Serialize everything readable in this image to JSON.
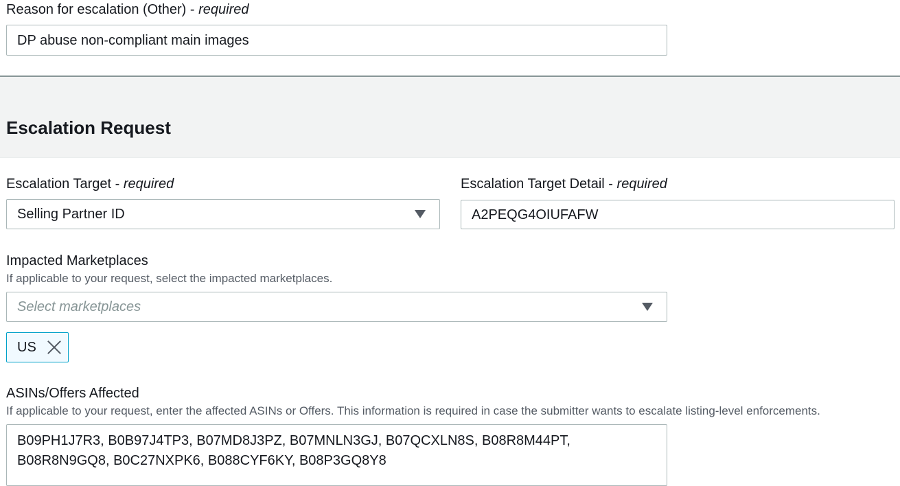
{
  "reason": {
    "label": "Reason for escalation (Other)",
    "required": "required",
    "value": "DP abuse non-compliant main images"
  },
  "section": {
    "title": "Escalation Request"
  },
  "target": {
    "label": "Escalation Target",
    "required": "required",
    "value": "Selling Partner ID"
  },
  "target_detail": {
    "label": "Escalation Target Detail",
    "required": "required",
    "value": "A2PEQG4OIUFAFW"
  },
  "marketplaces": {
    "label": "Impacted Marketplaces",
    "description": "If applicable to your request, select the impacted marketplaces.",
    "placeholder": "Select marketplaces",
    "selected_token": "US"
  },
  "asins": {
    "label": "ASINs/Offers Affected",
    "description": "If applicable to your request, enter the affected ASINs or Offers. This information is required in case the submitter wants to escalate listing-level enforcements.",
    "value": "B09PH1J7R3, B0B97J4TP3, B07MD8J3PZ, B07MNLN3GJ, B07QCXLN8S, B08R8M44PT,\nB08R8N9GQ8, B0C27NXPK6, B088CYF6KY, B08P3GQ8Y8"
  },
  "separator": " - "
}
